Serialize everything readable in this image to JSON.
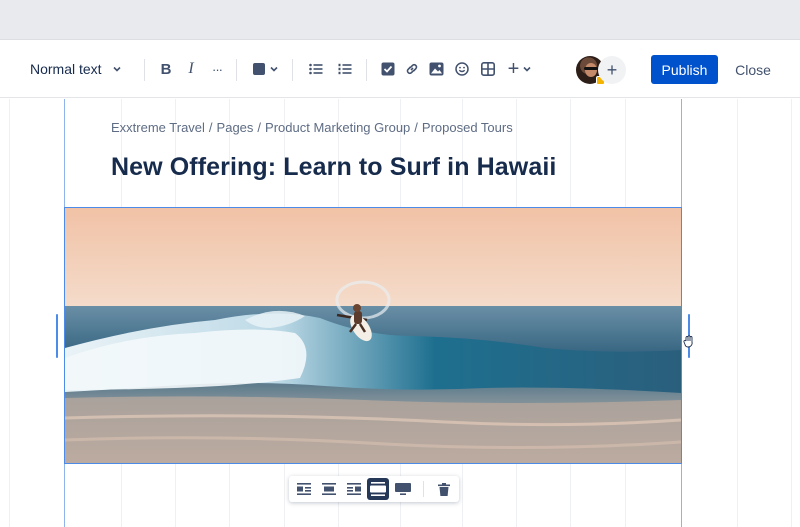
{
  "toolbar": {
    "text_style": "Normal text",
    "bold_label": "B",
    "italic_label": "I",
    "more_label": "···",
    "insert_label": "+",
    "icons": [
      "text-color-icon",
      "bullet-list-icon",
      "numbered-list-icon",
      "task-checkbox-icon",
      "link-icon",
      "image-icon",
      "emoji-icon",
      "table-icon",
      "insert-plus-icon"
    ]
  },
  "header": {
    "add_collaborator_label": "+",
    "publish_label": "Publish",
    "close_label": "Close"
  },
  "page": {
    "breadcrumb": [
      "Exxtreme Travel",
      "Pages",
      "Product Marketing Group",
      "Proposed Tours"
    ],
    "breadcrumb_separator": "/",
    "title": "New Offering: Learn to Surf in Hawaii"
  },
  "image_toolbar": {
    "buttons": [
      "wrap-left-icon",
      "align-center-icon",
      "wrap-right-icon",
      "wide-icon",
      "full-width-icon",
      "delete-icon"
    ],
    "active": "wide-icon"
  },
  "colors": {
    "primary": "#0052cc",
    "selection": "#4c8be8",
    "text": "#172b4d",
    "subtle": "#5e6c84"
  }
}
